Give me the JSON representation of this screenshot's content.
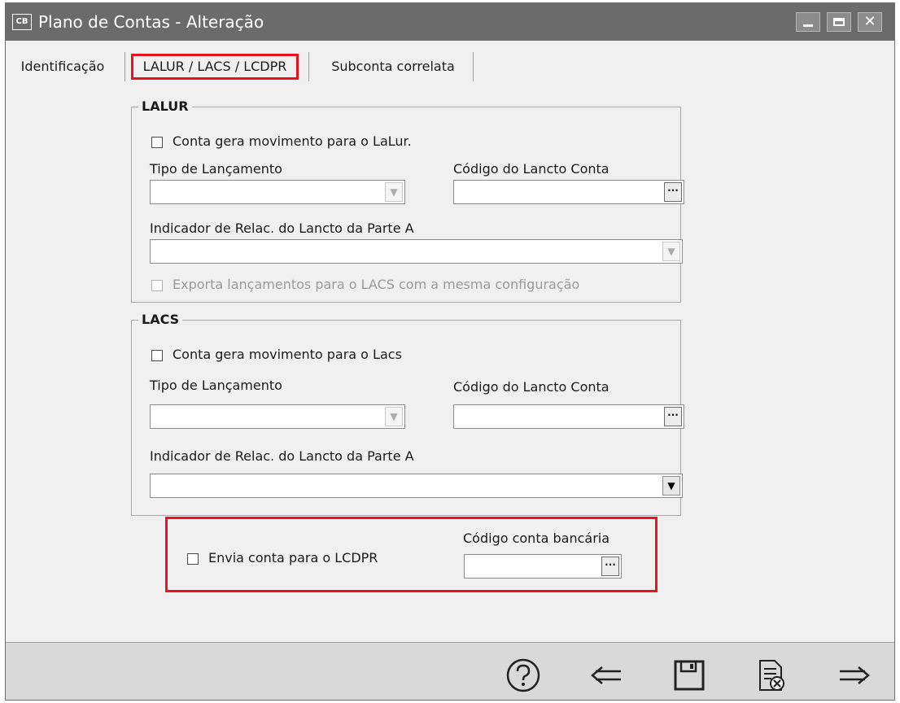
{
  "window": {
    "app_icon": "CB",
    "title": "Plano de Contas - Alteração"
  },
  "tabs": [
    {
      "label": "Identificação"
    },
    {
      "label": "LALUR / LACS / LCDPR"
    },
    {
      "label": "Subconta correlata"
    }
  ],
  "lalur": {
    "title": "LALUR",
    "movement_checkbox": "Conta gera movimento para o LaLur.",
    "tipo_label": "Tipo de Lançamento",
    "codigo_label": "Código do Lancto Conta",
    "indicador_label": "Indicador de Relac. do Lancto da Parte A",
    "export_checkbox": "Exporta lançamentos para o LACS com a mesma configuração"
  },
  "lacs": {
    "title": "LACS",
    "movement_checkbox": "Conta gera movimento para o Lacs",
    "tipo_label": "Tipo de Lançamento",
    "codigo_label": "Código do Lancto Conta",
    "indicador_label": "Indicador de Relac. do Lancto da Parte A"
  },
  "lcdpr": {
    "checkbox_label": "Envia conta para o LCDPR",
    "bank_code_label": "Código conta bancária"
  },
  "lookup_button": "···",
  "footer": {
    "icons": [
      "help-icon",
      "back-arrow-icon",
      "save-icon",
      "cancel-document-icon",
      "forward-arrow-icon"
    ]
  },
  "colors": {
    "titlebar": "#6b6b6b",
    "highlight": "#e8141c",
    "window_bg": "#f0f0f0",
    "footer_bg": "#d9d9d9"
  }
}
